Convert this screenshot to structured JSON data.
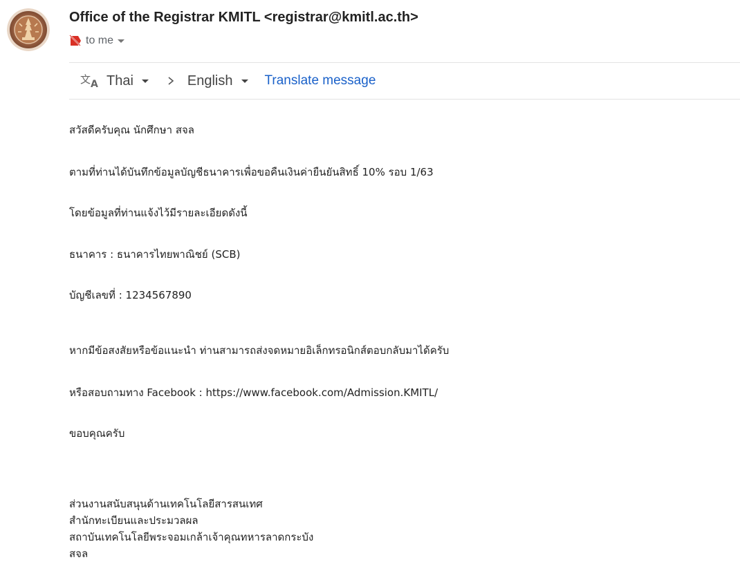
{
  "sender": {
    "display": "Office of the Registrar KMITL <registrar@kmitl.ac.th>",
    "avatar_icon": "kmitl-seal-logo"
  },
  "recipient": {
    "label": "to me",
    "label_icon": "important-label-icon"
  },
  "translate_bar": {
    "icon": "translate-icon",
    "from_language": "Thai",
    "to_language": "English",
    "action": "Translate message"
  },
  "message": {
    "greeting": "สวัสดีครับคุณ นักศึกษา สจล",
    "line1": "ตามที่ท่านได้บันทึกข้อมูลบัญชีธนาคารเพื่อขอคืนเงินค่ายืนยันสิทธิ์ 10% รอบ 1/63",
    "line2": "โดยข้อมูลที่ท่านแจ้งไว้มีรายละเอียดดังนี้",
    "bank": "ธนาคาร : ธนาคารไทยพาณิชย์ (SCB)",
    "account": "บัญชีเลขที่ : 1234567890",
    "contact1": "หากมีข้อสงสัยหรือข้อแนะนำ ท่านสามารถส่งจดหมายอิเล็กทรอนิกส์ตอบกลับมาได้ครับ",
    "contact2": "หรือสอบถามทาง Facebook : https://www.facebook.com/Admission.KMITL/",
    "thanks": "ขอบคุณครับ",
    "signature": [
      "ส่วนงานสนับสนุนด้านเทคโนโลยีสารสนเทศ",
      "สำนักทะเบียนและประมวลผล",
      "สถาบันเทคโนโลยีพระจอมเกล้าเจ้าคุณทหารลาดกระบัง",
      "สจล"
    ]
  },
  "colors": {
    "link": "#1a61c9",
    "muted": "#5f6368",
    "text": "#222222",
    "label_red": "#d93025"
  }
}
